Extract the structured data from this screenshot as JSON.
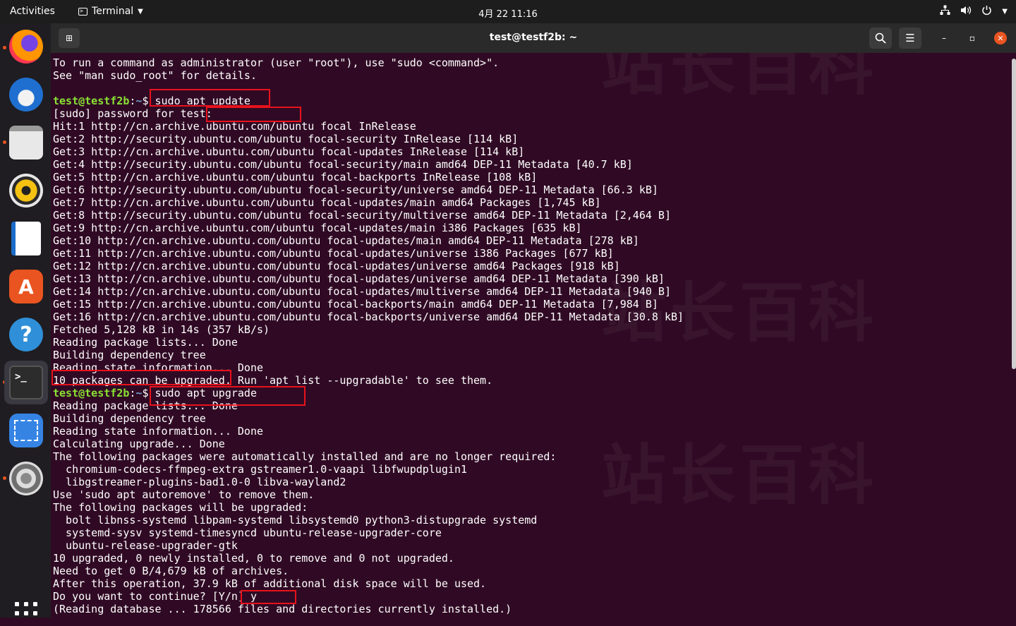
{
  "topbar": {
    "activities": "Activities",
    "app_name": "Terminal",
    "clock": "4月 22  11:16"
  },
  "window": {
    "title": "test@testf2b: ~"
  },
  "watermark": "站长百科",
  "accent_colors": {
    "highlight_box": "#e8121b",
    "prompt_user": "#8ae234",
    "prompt_path": "#729fcf",
    "terminal_bg": "#300a24"
  },
  "dock_icons": [
    "firefox-icon",
    "thunderbird-icon",
    "files-icon",
    "rhythmbox-icon",
    "libreoffice-writer-icon",
    "software-store-icon",
    "help-icon",
    "terminal-icon",
    "screenshot-icon",
    "settings-icon"
  ],
  "terminal": {
    "lines": [
      "To run a command as administrator (user \"root\"), use \"sudo <command>\".",
      "See \"man sudo_root\" for details.",
      "",
      {
        "prompt_user": "test@testf2b",
        "prompt_sep": ":",
        "prompt_path": "~",
        "prompt_end": "$ ",
        "cmd": "sudo apt update"
      },
      "[sudo] password for test:",
      "Hit:1 http://cn.archive.ubuntu.com/ubuntu focal InRelease",
      "Get:2 http://security.ubuntu.com/ubuntu focal-security InRelease [114 kB]",
      "Get:3 http://cn.archive.ubuntu.com/ubuntu focal-updates InRelease [114 kB]",
      "Get:4 http://security.ubuntu.com/ubuntu focal-security/main amd64 DEP-11 Metadata [40.7 kB]",
      "Get:5 http://cn.archive.ubuntu.com/ubuntu focal-backports InRelease [108 kB]",
      "Get:6 http://security.ubuntu.com/ubuntu focal-security/universe amd64 DEP-11 Metadata [66.3 kB]",
      "Get:7 http://cn.archive.ubuntu.com/ubuntu focal-updates/main amd64 Packages [1,745 kB]",
      "Get:8 http://security.ubuntu.com/ubuntu focal-security/multiverse amd64 DEP-11 Metadata [2,464 B]",
      "Get:9 http://cn.archive.ubuntu.com/ubuntu focal-updates/main i386 Packages [635 kB]",
      "Get:10 http://cn.archive.ubuntu.com/ubuntu focal-updates/main amd64 DEP-11 Metadata [278 kB]",
      "Get:11 http://cn.archive.ubuntu.com/ubuntu focal-updates/universe i386 Packages [677 kB]",
      "Get:12 http://cn.archive.ubuntu.com/ubuntu focal-updates/universe amd64 Packages [918 kB]",
      "Get:13 http://cn.archive.ubuntu.com/ubuntu focal-updates/universe amd64 DEP-11 Metadata [390 kB]",
      "Get:14 http://cn.archive.ubuntu.com/ubuntu focal-updates/multiverse amd64 DEP-11 Metadata [940 B]",
      "Get:15 http://cn.archive.ubuntu.com/ubuntu focal-backports/main amd64 DEP-11 Metadata [7,984 B]",
      "Get:16 http://cn.archive.ubuntu.com/ubuntu focal-backports/universe amd64 DEP-11 Metadata [30.8 kB]",
      "Fetched 5,128 kB in 14s (357 kB/s)",
      "Reading package lists... Done",
      "Building dependency tree",
      "Reading state information... Done",
      "10 packages can be upgraded. Run 'apt list --upgradable' to see them.",
      {
        "prompt_user": "test@testf2b",
        "prompt_sep": ":",
        "prompt_path": "~",
        "prompt_end": "$ ",
        "cmd": "sudo apt upgrade"
      },
      "Reading package lists... Done",
      "Building dependency tree",
      "Reading state information... Done",
      "Calculating upgrade... Done",
      "The following packages were automatically installed and are no longer required:",
      "  chromium-codecs-ffmpeg-extra gstreamer1.0-vaapi libfwupdplugin1",
      "  libgstreamer-plugins-bad1.0-0 libva-wayland2",
      "Use 'sudo apt autoremove' to remove them.",
      "The following packages will be upgraded:",
      "  bolt libnss-systemd libpam-systemd libsystemd0 python3-distupgrade systemd",
      "  systemd-sysv systemd-timesyncd ubuntu-release-upgrader-core",
      "  ubuntu-release-upgrader-gtk",
      "10 upgraded, 0 newly installed, 0 to remove and 0 not upgraded.",
      "Need to get 0 B/4,679 kB of archives.",
      "After this operation, 37.9 kB of additional disk space will be used.",
      "Do you want to continue? [Y/n] y",
      "(Reading database ... 178566 files and directories currently installed.)"
    ]
  }
}
